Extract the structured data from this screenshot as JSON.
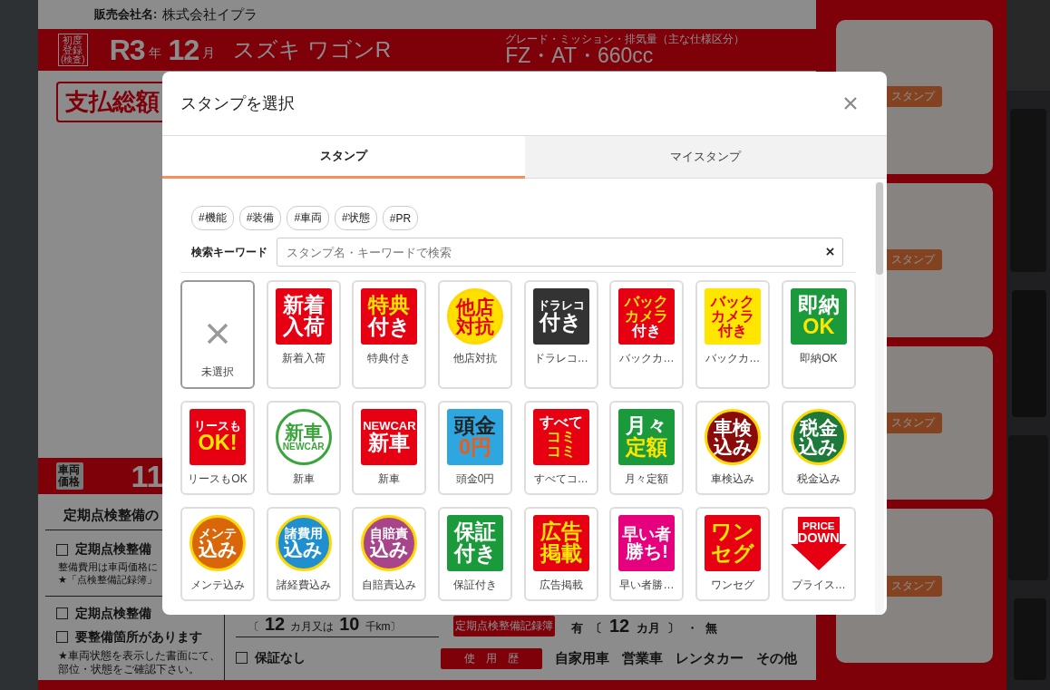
{
  "sheet": {
    "seller_label": "販売会社名:",
    "seller": "株式会社イプラ",
    "first_reg_badge": "初度登録",
    "first_reg_note": "(検査)",
    "era": "R3",
    "year_unit": "年",
    "month": "12",
    "month_unit": "月",
    "car_name": "スズキ ワゴンR",
    "spec_label": "グレード・ミッション・排気量（主な仕様区分）",
    "spec": "FZ・AT・660cc",
    "total_label": "支払総額",
    "price_badge": "車両価格",
    "price": "11",
    "inspection_title": "定期点検整備の",
    "checks": [
      {
        "label": "定期点検整備",
        "checked": false,
        "notes": [
          "整備費用は車両価格に",
          "★「点検整備記録簿」"
        ]
      },
      {
        "label": "定期点検整備",
        "checked": false
      },
      {
        "label": "要整備箇所があります",
        "checked": false,
        "notes": [
          "★車両状態を表示した書面にて、",
          "部位・状態をご確認下さい。"
        ]
      }
    ],
    "warranty": [
      "〔",
      "12",
      "カ月又は",
      "10",
      "千km〕"
    ],
    "warranty_none": {
      "label": "保証なし",
      "checked": false
    },
    "record_badge": "定期点検整備記録簿",
    "record": [
      "有",
      "〔",
      "12",
      "カ月",
      "〕",
      "・",
      "無"
    ],
    "usage_badge": "使　用　歴",
    "usage": [
      "自家用車",
      "営業車",
      "レンタカー",
      "その他"
    ]
  },
  "stamp_slots": [
    {
      "label": "スタンプ"
    },
    {
      "label": "スタンプ"
    },
    {
      "label": "スタンプ"
    },
    {
      "label": "スタンプ"
    }
  ],
  "modal": {
    "title": "スタンプを選択",
    "tabs": [
      {
        "label": "スタンプ",
        "selected": true
      },
      {
        "label": "マイスタンプ",
        "selected": false
      }
    ],
    "tags": [
      "#機能",
      "#装備",
      "#車両",
      "#状態",
      "#PR"
    ],
    "search": {
      "label": "検索キーワード",
      "placeholder": "スタンプ名・キーワードで検索"
    },
    "none_option": {
      "label": "未選択",
      "selected": true
    },
    "stamps": [
      {
        "label": "新着入荷",
        "kind": "square",
        "color": "#e60012",
        "selected": false,
        "lines": [
          {
            "text": "新着",
            "color": "#ffffff"
          },
          {
            "text": "入荷",
            "color": "#ffffff"
          }
        ]
      },
      {
        "label": "特典付き",
        "kind": "square",
        "color": "#e60012",
        "selected": false,
        "lines": [
          {
            "text": "特典",
            "color": "#ffe600"
          },
          {
            "text": "付き",
            "color": "#ffffff"
          }
        ]
      },
      {
        "label": "他店対抗",
        "kind": "circle",
        "color": "#ffe100",
        "selected": false,
        "lines": [
          {
            "text": "他店",
            "color": "#e60012"
          },
          {
            "text": "対抗",
            "color": "#e60012"
          }
        ]
      },
      {
        "label": "ドラレコ…",
        "kind": "square",
        "color": "#333333",
        "selected": false,
        "lines": [
          {
            "text": "ドラレコ",
            "color": "#ffffff"
          },
          {
            "text": "付き",
            "color": "#ffffff"
          }
        ]
      },
      {
        "label": "バックカ…",
        "kind": "square",
        "color": "#e60012",
        "selected": false,
        "lines": [
          {
            "text": "バック",
            "color": "#ffe600"
          },
          {
            "text": "カメラ",
            "color": "#ffe600"
          },
          {
            "text": "付き",
            "color": "#ffffff"
          }
        ]
      },
      {
        "label": "バックカ…",
        "kind": "square",
        "color": "#ffe600",
        "selected": false,
        "lines": [
          {
            "text": "バック",
            "color": "#e60012"
          },
          {
            "text": "カメラ",
            "color": "#e60012"
          },
          {
            "text": "付き",
            "color": "#e60012"
          }
        ]
      },
      {
        "label": "即納OK",
        "kind": "square",
        "color": "#1a9a3a",
        "selected": false,
        "lines": [
          {
            "text": "即納",
            "color": "#ffffff"
          },
          {
            "text": "OK",
            "color": "#ffe600"
          }
        ]
      },
      {
        "label": "リースもOK",
        "kind": "square",
        "color": "#e60012",
        "selected": false,
        "lines": [
          {
            "text": "リースも",
            "color": "#ffffff"
          },
          {
            "text": "OK!",
            "color": "#ffe600"
          }
        ]
      },
      {
        "label": "新車",
        "kind": "ring",
        "color": "#ffffff",
        "selected": false,
        "lines": [
          {
            "text": "新車",
            "color": "#3aa53a"
          },
          {
            "text": "NEWCAR",
            "color": "#3aa53a"
          }
        ]
      },
      {
        "label": "新車",
        "kind": "square",
        "color": "#e60012",
        "selected": false,
        "lines": [
          {
            "text": "NEWCAR",
            "color": "#ffffff"
          },
          {
            "text": "新車",
            "color": "#ffffff"
          }
        ]
      },
      {
        "label": "頭金0円",
        "kind": "square",
        "color": "#2ea7e0",
        "selected": false,
        "lines": [
          {
            "text": "頭金",
            "color": "#222222"
          },
          {
            "text": "0円",
            "color": "#f05a14"
          }
        ]
      },
      {
        "label": "すべてコ…",
        "kind": "square",
        "color": "#e60012",
        "selected": false,
        "lines": [
          {
            "text": "すべて",
            "color": "#ffffff"
          },
          {
            "text": "コミ",
            "color": "#ffe600"
          },
          {
            "text": "コミ",
            "color": "#ffe600"
          }
        ]
      },
      {
        "label": "月々定額",
        "kind": "square",
        "color": "#1a9a3a",
        "selected": false,
        "lines": [
          {
            "text": "月々",
            "color": "#ffffff"
          },
          {
            "text": "定額",
            "color": "#ffe600"
          }
        ]
      },
      {
        "label": "車検込み",
        "kind": "circle",
        "color": "#8b0a0a",
        "selected": false,
        "lines": [
          {
            "text": "車検",
            "color": "#ffffff"
          },
          {
            "text": "込み",
            "color": "#ffffff"
          }
        ]
      },
      {
        "label": "税金込み",
        "kind": "circle",
        "color": "#1d7a3a",
        "selected": false,
        "lines": [
          {
            "text": "税金",
            "color": "#ffffff"
          },
          {
            "text": "込み",
            "color": "#ffffff"
          }
        ]
      },
      {
        "label": "メンテ込み",
        "kind": "circle",
        "color": "#d9670a",
        "selected": false,
        "lines": [
          {
            "text": "メンテ",
            "color": "#ffffff"
          },
          {
            "text": "込み",
            "color": "#ffffff"
          }
        ]
      },
      {
        "label": "諸経費込み",
        "kind": "circle",
        "color": "#1f8fd0",
        "selected": false,
        "lines": [
          {
            "text": "諸費用",
            "color": "#ffffff"
          },
          {
            "text": "込み",
            "color": "#ffffff"
          }
        ]
      },
      {
        "label": "自賠責込み",
        "kind": "circle",
        "color": "#a8458a",
        "selected": false,
        "lines": [
          {
            "text": "自賠責",
            "color": "#ffffff"
          },
          {
            "text": "込み",
            "color": "#ffffff"
          }
        ]
      },
      {
        "label": "保証付き",
        "kind": "square",
        "color": "#1a9a3a",
        "selected": false,
        "lines": [
          {
            "text": "保証",
            "color": "#ffffff"
          },
          {
            "text": "付き",
            "color": "#ffffff"
          }
        ]
      },
      {
        "label": "広告掲載",
        "kind": "square",
        "color": "#e60012",
        "selected": false,
        "lines": [
          {
            "text": "広告",
            "color": "#ffe600"
          },
          {
            "text": "掲載",
            "color": "#ffe600"
          }
        ]
      },
      {
        "label": "早い者勝…",
        "kind": "square",
        "color": "#e6007e",
        "selected": false,
        "lines": [
          {
            "text": "早い者",
            "color": "#ffffff"
          },
          {
            "text": "勝ち!",
            "color": "#ffffff"
          }
        ]
      },
      {
        "label": "ワンセグ",
        "kind": "square",
        "color": "#e60012",
        "selected": false,
        "lines": [
          {
            "text": "ワン",
            "color": "#ffe600"
          },
          {
            "text": "セグ",
            "color": "#ffe600"
          }
        ]
      },
      {
        "label": "プライス…",
        "kind": "arrow",
        "color": "#e60012",
        "selected": false,
        "lines": [
          {
            "text": "PRICE",
            "color": "#ffffff"
          },
          {
            "text": "DOWN",
            "color": "#ffffff"
          }
        ]
      }
    ]
  }
}
